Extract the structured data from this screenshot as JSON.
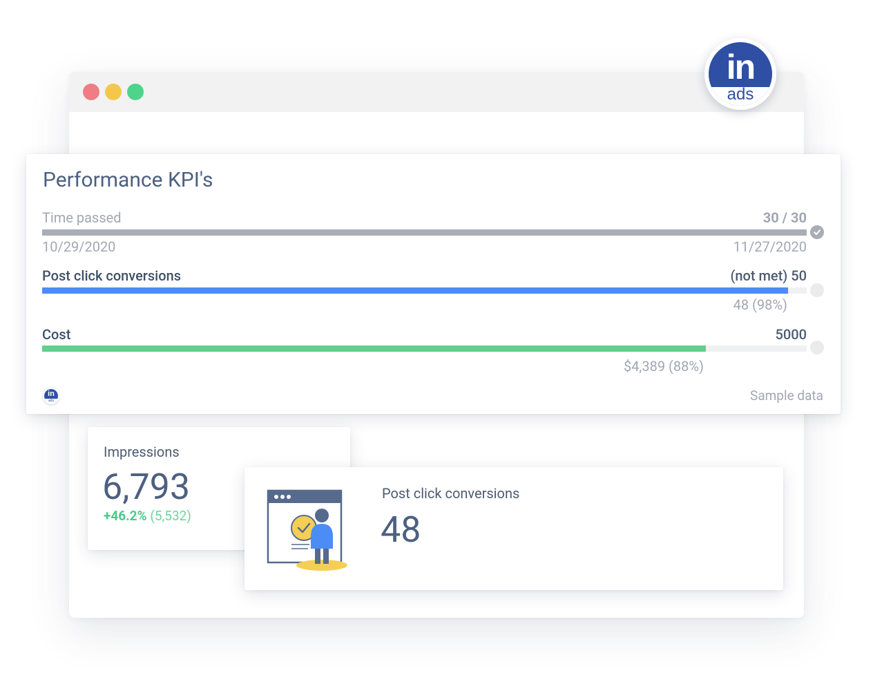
{
  "browser": {
    "buttons": [
      "close",
      "minimize",
      "maximize"
    ],
    "button_colors": [
      "#ef7d84",
      "#f3c84a",
      "#4ed48a"
    ]
  },
  "brand": {
    "logo_text": "in",
    "logo_sub": "ads",
    "logo_color": "#2e4fa3"
  },
  "kpi_card": {
    "title": "Performance KPI's",
    "rows": [
      {
        "label": "Time passed",
        "target": "30 / 30",
        "start_date": "10/29/2020",
        "end_date": "11/27/2020",
        "progress": 1.0,
        "bar_color": "#a9adb5",
        "status": "complete"
      },
      {
        "label": "Post click conversions",
        "target": "(not met) 50",
        "actual": "48 (98%)",
        "progress": 0.976,
        "bar_color": "#4c8cf5",
        "status": "pending"
      },
      {
        "label": "Cost",
        "target": "5000",
        "actual": "$4,389 (88%)",
        "progress": 0.868,
        "bar_color": "#5fd08d",
        "status": "pending"
      }
    ],
    "footer_note": "Sample data"
  },
  "impressions": {
    "label": "Impressions",
    "value": "6,793",
    "change": "+46.2%",
    "previous": "(5,532)"
  },
  "conversions": {
    "label": "Post click conversions",
    "value": "48",
    "illustration": "person-at-browser-checkmark-illustration"
  }
}
